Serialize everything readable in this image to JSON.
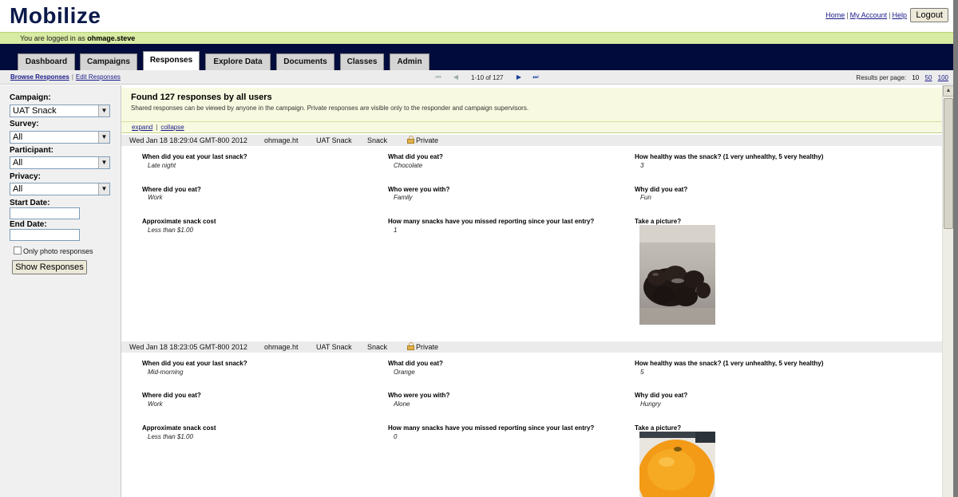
{
  "header": {
    "logo": "Mobilize",
    "links": {
      "home": "Home",
      "account": "My Account",
      "help": "Help"
    },
    "separator": "|",
    "logout": "Logout"
  },
  "login_bar": {
    "prefix": "You are logged in as",
    "username": "ohmage.steve"
  },
  "nav": {
    "tabs": [
      "Dashboard",
      "Campaigns",
      "Responses",
      "Explore Data",
      "Documents",
      "Classes",
      "Admin"
    ],
    "active": "Responses"
  },
  "subnav": {
    "browse": "Browse Responses",
    "edit": "Edit Responses",
    "separator": "|",
    "pager": "1-10 of 127",
    "results_label": "Results per page:",
    "results_options": [
      "10",
      "50",
      "100"
    ]
  },
  "sidebar": {
    "campaign_label": "Campaign:",
    "campaign_value": "UAT Snack",
    "survey_label": "Survey:",
    "survey_value": "All",
    "participant_label": "Participant:",
    "participant_value": "All",
    "privacy_label": "Privacy:",
    "privacy_value": "All",
    "start_label": "Start Date:",
    "end_label": "End Date:",
    "photo_only": "Only photo responses",
    "show_button": "Show Responses"
  },
  "summary": {
    "found": "Found 127 responses by all users",
    "note": "Shared responses can be viewed by anyone in the campaign. Private responses are visible only to the responder and campaign supervisors.",
    "expand": "expand",
    "collapse": "collapse",
    "separator": "|"
  },
  "responses": [
    {
      "timestamp": "Wed Jan 18 18:29:04 GMT-800 2012",
      "user": "ohmage.ht",
      "campaign": "UAT Snack",
      "survey": "Snack",
      "privacy": "Private",
      "photo": "chocolate",
      "qa": [
        {
          "q": "When did you eat your last snack?",
          "a": "Late night"
        },
        {
          "q": "What did you eat?",
          "a": "Chocolate"
        },
        {
          "q": "How healthy was the snack? (1 very unhealthy, 5 very healthy)",
          "a": "3"
        },
        {
          "q": "Where did you eat?",
          "a": "Work"
        },
        {
          "q": "Who were you with?",
          "a": "Family"
        },
        {
          "q": "Why did you eat?",
          "a": "Fun"
        },
        {
          "q": "Approximate snack cost",
          "a": "Less than $1.00"
        },
        {
          "q": "How many snacks have you missed reporting since your last entry?",
          "a": "1"
        },
        {
          "q": "Take a picture?",
          "a": ""
        }
      ]
    },
    {
      "timestamp": "Wed Jan 18 18:23:05 GMT-800 2012",
      "user": "ohmage.ht",
      "campaign": "UAT Snack",
      "survey": "Snack",
      "privacy": "Private",
      "photo": "orange",
      "qa": [
        {
          "q": "When did you eat your last snack?",
          "a": "Mid-morning"
        },
        {
          "q": "What did you eat?",
          "a": "Orange"
        },
        {
          "q": "How healthy was the snack? (1 very unhealthy, 5 very healthy)",
          "a": "5"
        },
        {
          "q": "Where did you eat?",
          "a": "Work"
        },
        {
          "q": "Who were you with?",
          "a": "Alone"
        },
        {
          "q": "Why did you eat?",
          "a": "Hungry"
        },
        {
          "q": "Approximate snack cost",
          "a": "Less than $1.00"
        },
        {
          "q": "How many snacks have you missed reporting since your last entry?",
          "a": "0"
        },
        {
          "q": "Take a picture?",
          "a": ""
        }
      ]
    }
  ],
  "colors": {
    "navbar": "#020c3c",
    "login_bar": "#d8eba2",
    "summary_bg": "#f7fae0",
    "logo": "#0b1a4a"
  }
}
